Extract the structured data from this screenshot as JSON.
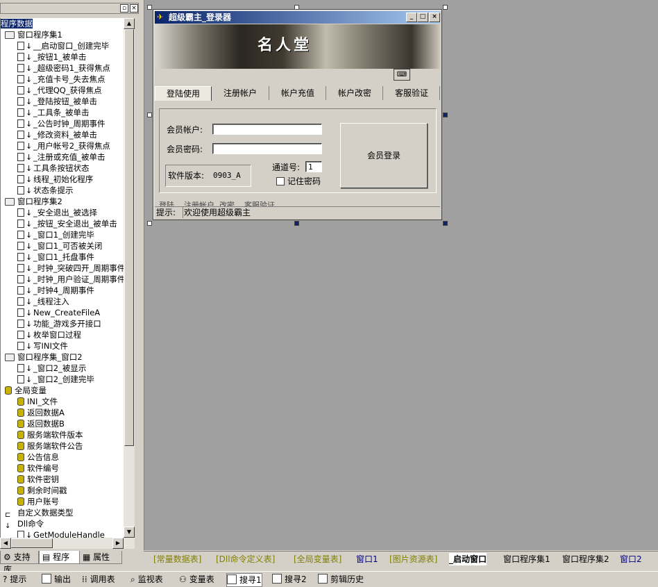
{
  "tree": {
    "root": "程序数据",
    "items": [
      {
        "level": 1,
        "icon": "book",
        "label": "窗口程序集1"
      },
      {
        "level": 2,
        "icon": "doc",
        "label": "__启动窗口_创建完毕"
      },
      {
        "level": 2,
        "icon": "doc",
        "label": "_按钮1_被单击"
      },
      {
        "level": 2,
        "icon": "doc",
        "label": "_超级密码1_获得焦点"
      },
      {
        "level": 2,
        "icon": "doc",
        "label": "_充值卡号_失去焦点"
      },
      {
        "level": 2,
        "icon": "doc",
        "label": "_代理QQ_获得焦点"
      },
      {
        "level": 2,
        "icon": "doc",
        "label": "_登陆按钮_被单击"
      },
      {
        "level": 2,
        "icon": "doc",
        "label": "_工具条_被单击"
      },
      {
        "level": 2,
        "icon": "doc",
        "label": "_公告时钟_周期事件"
      },
      {
        "level": 2,
        "icon": "doc",
        "label": "_修改资料_被单击"
      },
      {
        "level": 2,
        "icon": "doc",
        "label": "_用户帐号2_获得焦点"
      },
      {
        "level": 2,
        "icon": "doc",
        "label": "_注册或充值_被单击"
      },
      {
        "level": 2,
        "icon": "doc",
        "label": "工具条按钮状态"
      },
      {
        "level": 2,
        "icon": "doc",
        "label": "线程_初始化程序"
      },
      {
        "level": 2,
        "icon": "doc",
        "label": "状态条提示"
      },
      {
        "level": 1,
        "icon": "book",
        "label": "窗口程序集2"
      },
      {
        "level": 2,
        "icon": "doc",
        "label": "_安全退出_被选择"
      },
      {
        "level": 2,
        "icon": "doc",
        "label": "_按钮_安全退出_被单击"
      },
      {
        "level": 2,
        "icon": "doc",
        "label": "_窗口1_创建完毕"
      },
      {
        "level": 2,
        "icon": "doc",
        "label": "_窗口1_可否被关闭"
      },
      {
        "level": 2,
        "icon": "doc",
        "label": "_窗口1_托盘事件"
      },
      {
        "level": 2,
        "icon": "doc",
        "label": "_时钟_突破四开_周期事件"
      },
      {
        "level": 2,
        "icon": "doc",
        "label": "_时钟_用户验证_周期事件"
      },
      {
        "level": 2,
        "icon": "doc",
        "label": "_时钟4_周期事件"
      },
      {
        "level": 2,
        "icon": "doc",
        "label": "_线程注入"
      },
      {
        "level": 2,
        "icon": "doc",
        "label": "New_CreateFileA"
      },
      {
        "level": 2,
        "icon": "doc",
        "label": "功能_游戏多开接口"
      },
      {
        "level": 2,
        "icon": "doc",
        "label": "枚举窗口过程"
      },
      {
        "level": 2,
        "icon": "doc",
        "label": "写INI文件"
      },
      {
        "level": 1,
        "icon": "book",
        "label": "窗口程序集_窗口2"
      },
      {
        "level": 2,
        "icon": "doc",
        "label": "_窗口2_被显示"
      },
      {
        "level": 2,
        "icon": "doc",
        "label": "_窗口2_创建完毕"
      },
      {
        "level": 1,
        "icon": "db",
        "label": "全局变量"
      },
      {
        "level": 2,
        "icon": "db",
        "label": "INI_文件"
      },
      {
        "level": 2,
        "icon": "db",
        "label": "返回数据A"
      },
      {
        "level": 2,
        "icon": "db",
        "label": "返回数据B"
      },
      {
        "level": 2,
        "icon": "db",
        "label": "服务端软件版本"
      },
      {
        "level": 2,
        "icon": "db",
        "label": "服务端软件公告"
      },
      {
        "level": 2,
        "icon": "db",
        "label": "公告信息"
      },
      {
        "level": 2,
        "icon": "db",
        "label": "软件编号"
      },
      {
        "level": 2,
        "icon": "db",
        "label": "软件密钥"
      },
      {
        "level": 2,
        "icon": "db",
        "label": "剩余时间戳"
      },
      {
        "level": 2,
        "icon": "db",
        "label": "用户账号"
      },
      {
        "level": 1,
        "icon": "struct",
        "label": "自定义数据类型"
      },
      {
        "level": 1,
        "icon": "dll",
        "label": "Dll命令"
      },
      {
        "level": 2,
        "icon": "doc",
        "label": "GetModuleHandle"
      }
    ]
  },
  "left_tabs": [
    "支持库",
    "程序",
    "属性"
  ],
  "window": {
    "title": "超级霸主_登录器",
    "banner_logo": "名人堂",
    "tabs": [
      "登陆使用",
      "注册帐户",
      "帐户充值",
      "帐户改密",
      "客服验证"
    ],
    "account_label": "会员帐户:",
    "password_label": "会员密码:",
    "version_label": "软件版本:",
    "version_value": "0903_A",
    "channel_label": "通道号:",
    "channel_value": "1",
    "remember_label": "记住密码",
    "login_button": "会员登录",
    "ghost_tabs": "登陆    注册帐户  改密    客服验证",
    "status_label": "提示:",
    "status_text": "欢迎使用超级霸主"
  },
  "file_tabs": [
    {
      "label": "[常量数据表]",
      "color": "#808000"
    },
    {
      "label": "[Dll命令定义表]",
      "color": "#808000"
    },
    {
      "label": "[全局变量表]",
      "color": "#808000"
    },
    {
      "label": "窗口1",
      "color": "#000080"
    },
    {
      "label": "[图片资源表]",
      "color": "#808000"
    },
    {
      "label": "_启动窗口",
      "color": "#000000"
    },
    {
      "label": "窗口程序集1",
      "color": "#000000"
    },
    {
      "label": "窗口程序集2",
      "color": "#000000"
    },
    {
      "label": "窗口2",
      "color": "#000080"
    }
  ],
  "bottom_bar": [
    "提示",
    "输出",
    "调用表",
    "监视表",
    "变量表",
    "搜寻1",
    "搜寻2",
    "剪辑历史"
  ]
}
